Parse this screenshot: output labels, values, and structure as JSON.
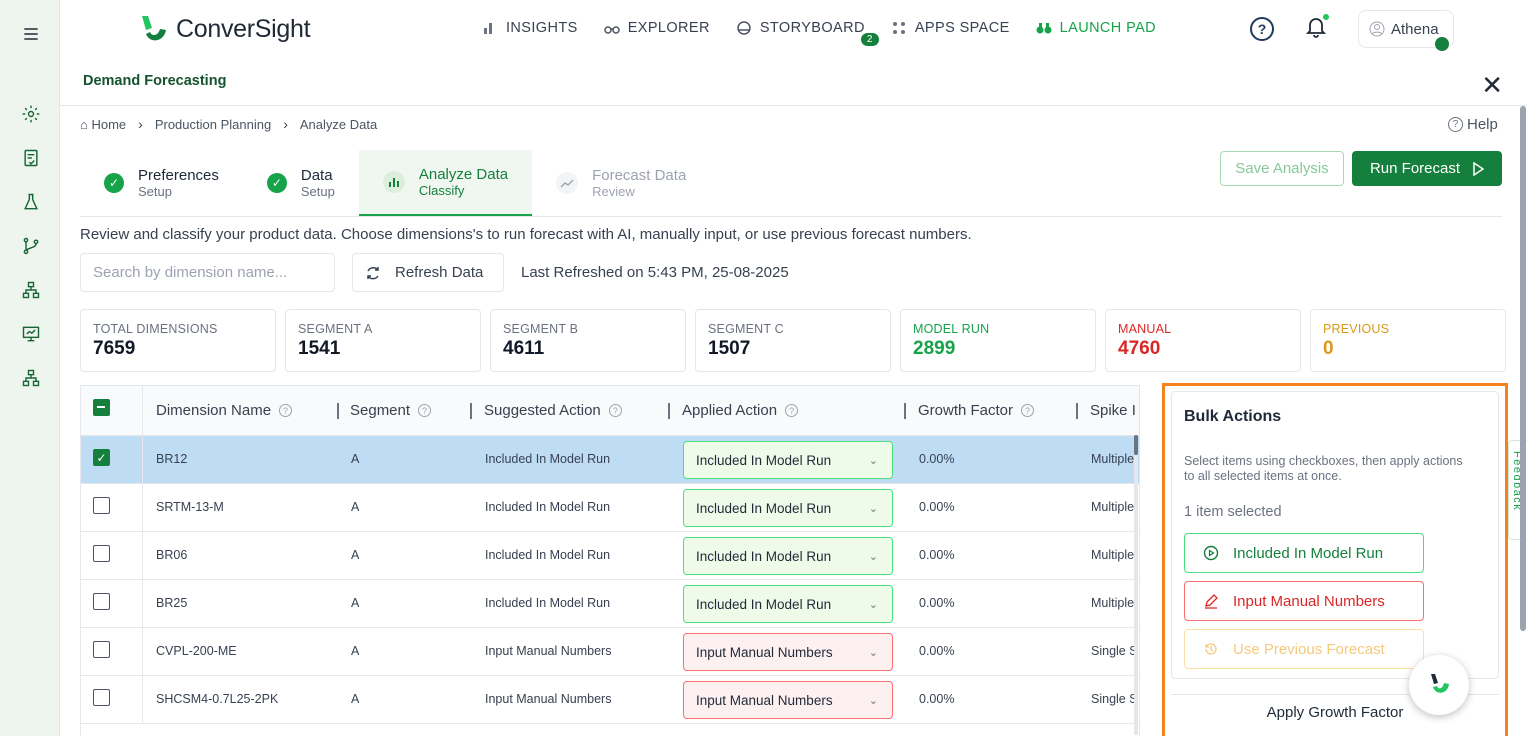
{
  "app": {
    "brand": "ConverSight",
    "nav": [
      {
        "label": "INSIGHTS",
        "icon": "bar-chart-icon"
      },
      {
        "label": "EXPLORER",
        "icon": "binoculars-icon"
      },
      {
        "label": "STORYBOARD",
        "icon": "storyboard-icon",
        "badge": "2"
      },
      {
        "label": "APPS SPACE",
        "icon": "apps-grid-icon"
      },
      {
        "label": "LAUNCH PAD",
        "icon": "launchpad-binoculars-icon",
        "active": true
      }
    ],
    "user": "Athena",
    "accent": "#15803d"
  },
  "rail": [
    "menu-icon",
    "settings-icon",
    "document-check-icon",
    "flask-icon",
    "git-branch-icon",
    "hierarchy-icon",
    "presentation-icon",
    "hierarchy-icon"
  ],
  "page": {
    "title": "Demand Forecasting",
    "help": "Help",
    "breadcrumb": [
      "Home",
      "Production Planning",
      "Analyze Data"
    ]
  },
  "steps": [
    {
      "title": "Preferences",
      "sub": "Setup",
      "state": "done"
    },
    {
      "title": "Data",
      "sub": "Setup",
      "state": "done"
    },
    {
      "title": "Analyze Data",
      "sub": "Classify",
      "state": "active"
    },
    {
      "title": "Forecast Data",
      "sub": "Review",
      "state": "future"
    }
  ],
  "actions": {
    "save": "Save Analysis",
    "run": "Run Forecast"
  },
  "description": "Review and classify your product data. Choose dimensions's to run forecast with AI, manually input, or use previous forecast numbers.",
  "search": {
    "placeholder": "Search by dimension name..."
  },
  "refresh": {
    "label": "Refresh Data",
    "last": "Last Refreshed on 5:43 PM, 25-08-2025"
  },
  "stats": [
    {
      "label": "TOTAL DIMENSIONS",
      "value": "7659",
      "color": "#111827",
      "labelColor": "#6b7280"
    },
    {
      "label": "SEGMENT A",
      "value": "1541",
      "color": "#111827",
      "labelColor": "#6b7280"
    },
    {
      "label": "SEGMENT B",
      "value": "4611",
      "color": "#111827",
      "labelColor": "#6b7280"
    },
    {
      "label": "SEGMENT C",
      "value": "1507",
      "color": "#111827",
      "labelColor": "#6b7280"
    },
    {
      "label": "MODEL RUN",
      "value": "2899",
      "color": "#16a34a",
      "labelColor": "#16a34a"
    },
    {
      "label": "MANUAL",
      "value": "4760",
      "color": "#dc2626",
      "labelColor": "#dc2626"
    },
    {
      "label": "PREVIOUS",
      "value": "0",
      "color": "#d99a1b",
      "labelColor": "#d99a1b"
    }
  ],
  "table": {
    "columns": [
      "Dimension Name",
      "Segment",
      "Suggested Action",
      "Applied Action",
      "Growth Factor",
      "Spike I"
    ],
    "rows": [
      {
        "name": "BR12",
        "segment": "A",
        "suggested": "Included In Model Run",
        "applied": "Included In Model Run",
        "growth": "0.00%",
        "spike": "Multiple",
        "selected": true,
        "kind": "green"
      },
      {
        "name": "SRTM-13-M",
        "segment": "A",
        "suggested": "Included In Model Run",
        "applied": "Included In Model Run",
        "growth": "0.00%",
        "spike": "Multiple",
        "selected": false,
        "kind": "green"
      },
      {
        "name": "BR06",
        "segment": "A",
        "suggested": "Included In Model Run",
        "applied": "Included In Model Run",
        "growth": "0.00%",
        "spike": "Multiple",
        "selected": false,
        "kind": "green"
      },
      {
        "name": "BR25",
        "segment": "A",
        "suggested": "Included In Model Run",
        "applied": "Included In Model Run",
        "growth": "0.00%",
        "spike": "Multiple",
        "selected": false,
        "kind": "green"
      },
      {
        "name": "CVPL-200-ME",
        "segment": "A",
        "suggested": "Input Manual Numbers",
        "applied": "Input Manual Numbers",
        "growth": "0.00%",
        "spike": "Single S",
        "selected": false,
        "kind": "red"
      },
      {
        "name": "SHCSM4-0.7L25-2PK",
        "segment": "A",
        "suggested": "Input Manual Numbers",
        "applied": "Input Manual Numbers",
        "growth": "0.00%",
        "spike": "Single S",
        "selected": false,
        "kind": "red"
      }
    ]
  },
  "bulk": {
    "title": "Bulk Actions",
    "help": "Select items using checkboxes, then apply actions to all selected items at once.",
    "selected": "1 item selected",
    "btn_model": "Included In Model Run",
    "btn_manual": "Input Manual Numbers",
    "btn_previous": "Use Previous Forecast",
    "apply": "Apply Growth Factor"
  },
  "feedback": "Feedback"
}
